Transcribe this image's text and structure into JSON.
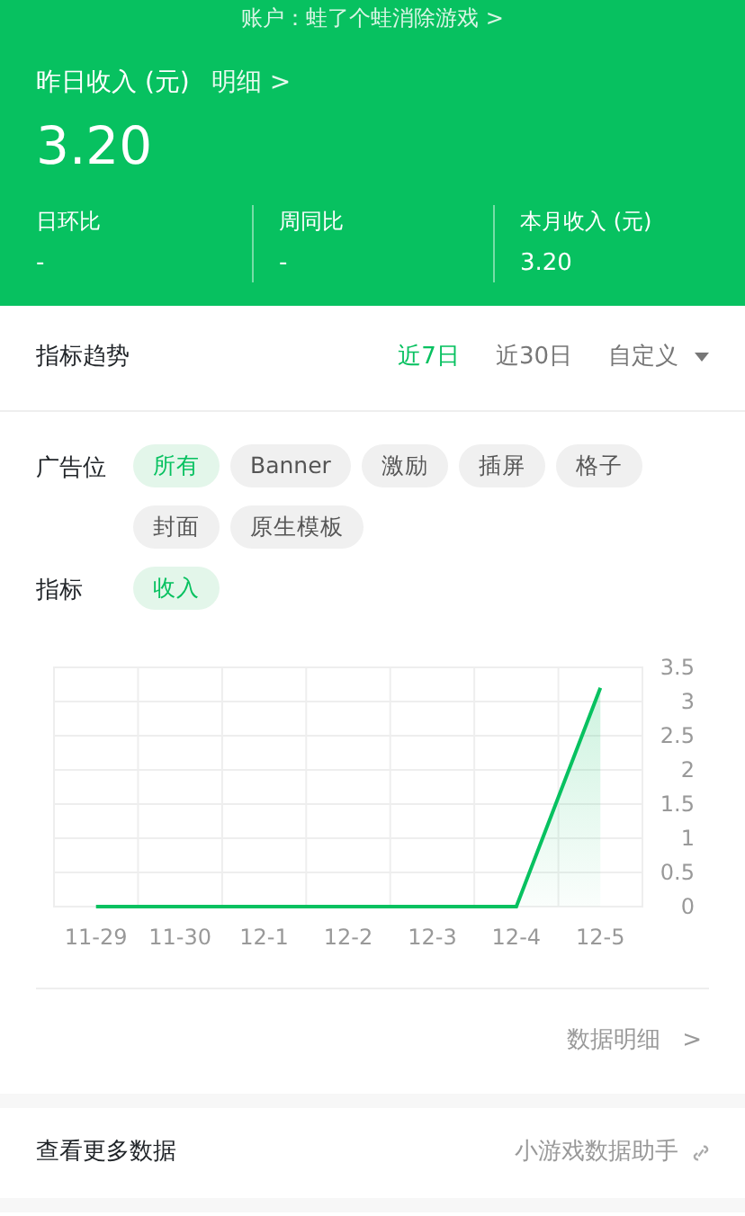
{
  "account": {
    "label": "账户：蛙了个蛙消除游戏",
    "chevron": ">"
  },
  "income": {
    "title": "昨日收入 (元)",
    "detail_link": "明细",
    "chevron": ">",
    "value": "3.20",
    "stats": [
      {
        "label": "日环比",
        "value": "-"
      },
      {
        "label": "周同比",
        "value": "-"
      },
      {
        "label": "本月收入 (元)",
        "value": "3.20"
      }
    ]
  },
  "trend": {
    "title": "指标趋势",
    "tabs": [
      {
        "label": "近7日",
        "selected": true,
        "kind": "tab"
      },
      {
        "label": "近30日",
        "selected": false,
        "kind": "tab"
      },
      {
        "label": "自定义",
        "selected": false,
        "kind": "dropdown"
      }
    ],
    "filters": [
      {
        "label": "广告位",
        "chips": [
          {
            "label": "所有",
            "selected": true
          },
          {
            "label": "Banner",
            "selected": false
          },
          {
            "label": "激励",
            "selected": false
          },
          {
            "label": "插屏",
            "selected": false
          },
          {
            "label": "格子",
            "selected": false
          },
          {
            "label": "封面",
            "selected": false
          },
          {
            "label": "原生模板",
            "selected": false
          }
        ]
      },
      {
        "label": "指标",
        "chips": [
          {
            "label": "收入",
            "selected": true
          }
        ]
      }
    ],
    "chart_data": {
      "type": "area",
      "categories": [
        "11-29",
        "11-30",
        "12-1",
        "12-2",
        "12-3",
        "12-4",
        "12-5"
      ],
      "grid": true,
      "series": [
        {
          "color": "#07c160",
          "values": [
            0,
            0,
            0,
            0,
            0,
            0,
            3.2
          ]
        }
      ],
      "ylim": [
        0,
        3.5
      ],
      "yticks": [
        0,
        {
          "value": 0.5,
          "label": "0.5"
        },
        1,
        {
          "value": 1.5,
          "label": "1.5"
        },
        2,
        {
          "value": 2.5,
          "label": "2.5"
        },
        3,
        {
          "value": 3.5,
          "label": "3.5"
        }
      ]
    },
    "detail_link": {
      "label": "数据明细",
      "chevron": ">"
    }
  },
  "more": {
    "label": "查看更多数据",
    "link": "小游戏数据助手"
  }
}
